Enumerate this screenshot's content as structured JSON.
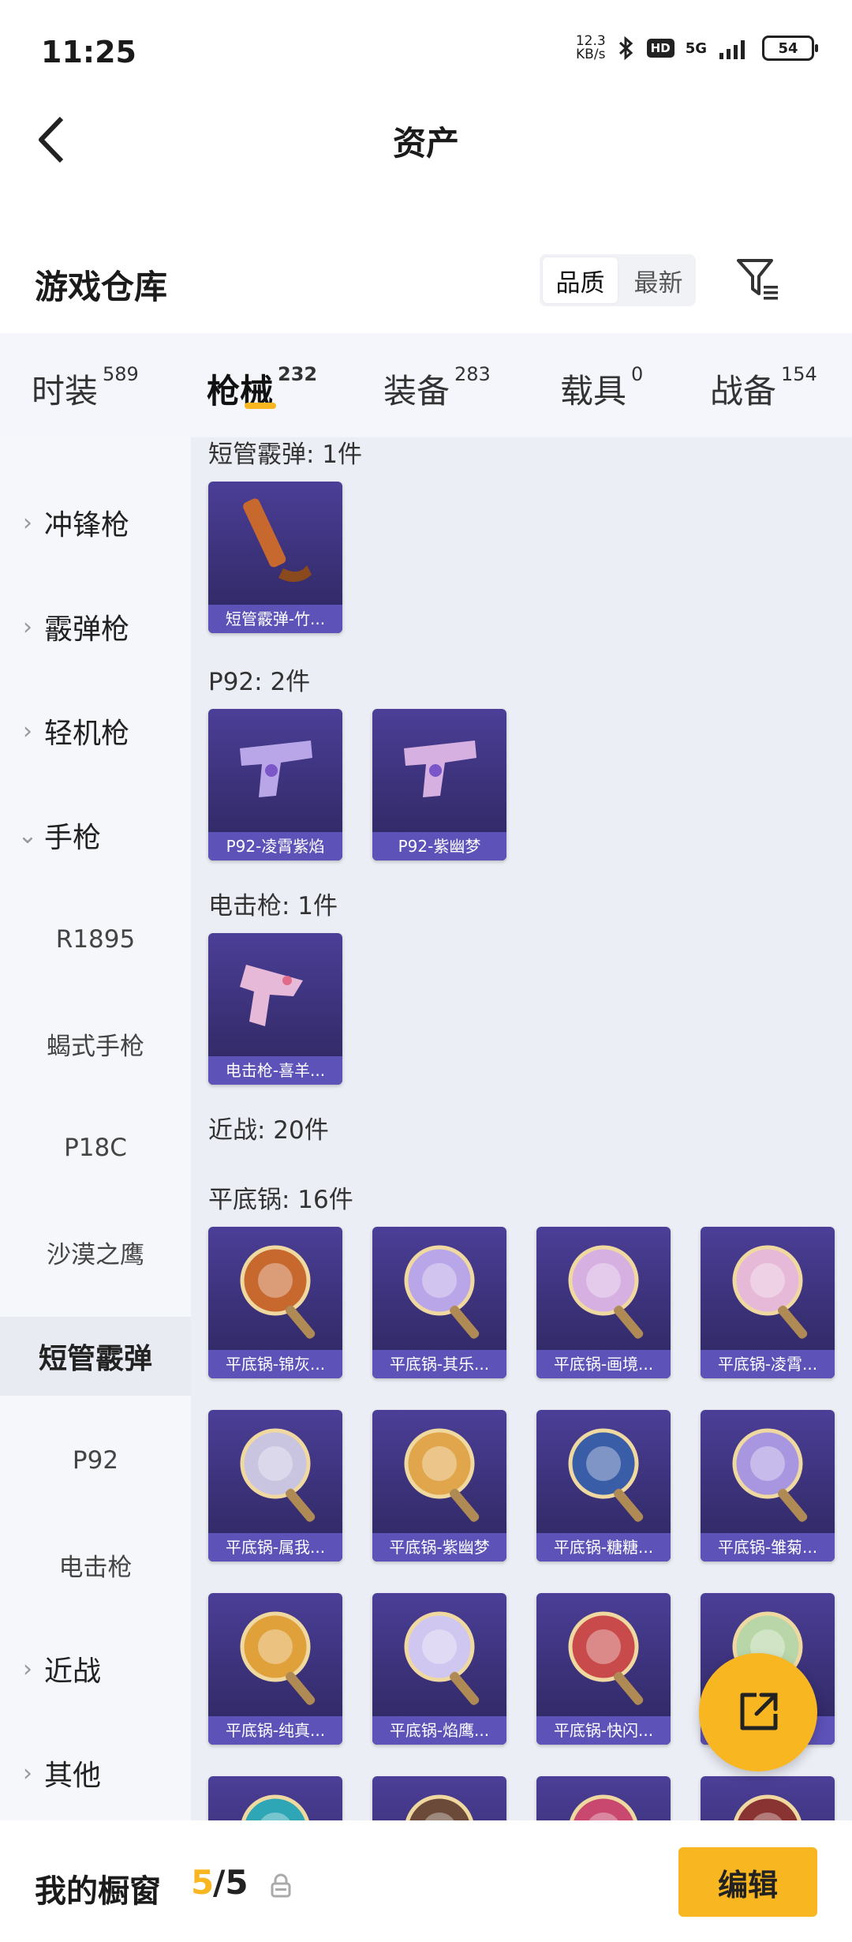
{
  "status": {
    "time": "11:25",
    "speed_value": "12.3",
    "speed_unit": "KB/s",
    "hd": "HD",
    "network": "5G",
    "battery": "54"
  },
  "header": {
    "title": "资产",
    "back_icon": "chevron-left-icon"
  },
  "section": {
    "title": "游戏仓库",
    "sort": [
      "品质",
      "最新"
    ],
    "sort_selected": "品质",
    "filter_icon": "filter-icon"
  },
  "tabs": [
    {
      "label": "时装",
      "count": "589"
    },
    {
      "label": "枪械",
      "count": "232",
      "active": true
    },
    {
      "label": "装备",
      "count": "283"
    },
    {
      "label": "载具",
      "count": "0"
    },
    {
      "label": "战备",
      "count": "154"
    }
  ],
  "sidebar": [
    {
      "label": "冲锋枪",
      "type": "collapsed"
    },
    {
      "label": "霰弹枪",
      "type": "collapsed"
    },
    {
      "label": "轻机枪",
      "type": "collapsed"
    },
    {
      "label": "手枪",
      "type": "expanded"
    },
    {
      "label": "R1895",
      "type": "sub"
    },
    {
      "label": "蝎式手枪",
      "type": "sub"
    },
    {
      "label": "P18C",
      "type": "sub"
    },
    {
      "label": "沙漠之鹰",
      "type": "sub"
    },
    {
      "label": "短管霰弹",
      "type": "selected"
    },
    {
      "label": "P92",
      "type": "sub"
    },
    {
      "label": "电击枪",
      "type": "sub"
    },
    {
      "label": "近战",
      "type": "collapsed"
    },
    {
      "label": "其他",
      "type": "collapsed"
    }
  ],
  "groups": [
    {
      "label": "短管霰弹: 1件",
      "items": [
        "短管霰弹-竹..."
      ]
    },
    {
      "label": "P92: 2件",
      "items": [
        "P92-凌霄紫焰",
        "P92-紫幽梦"
      ]
    },
    {
      "label": "电击枪: 1件",
      "items": [
        "电击枪-喜羊..."
      ]
    },
    {
      "label": "近战: 20件",
      "items": []
    },
    {
      "label": "平底锅: 16件",
      "items": [
        "平底锅-锦灰...",
        "平底锅-其乐...",
        "平底锅-画境...",
        "平底锅-凌霄...",
        "平底锅-属我...",
        "平底锅-紫幽梦",
        "平底锅-糖糖...",
        "平底锅-雏菊...",
        "平底锅-纯真...",
        "平底锅-焰鹰...",
        "平底锅-快闪...",
        "",
        "",
        "",
        "",
        ""
      ]
    }
  ],
  "fab": {
    "icon": "share-icon"
  },
  "bottom": {
    "label": "我的橱窗",
    "current": "5",
    "total": "/5",
    "lock_icon": "lock-icon",
    "edit": "编辑"
  },
  "colors": {
    "accent": "#f8b621",
    "card_bg": "#3b3180",
    "card_label_bg": "#5d52b8"
  }
}
